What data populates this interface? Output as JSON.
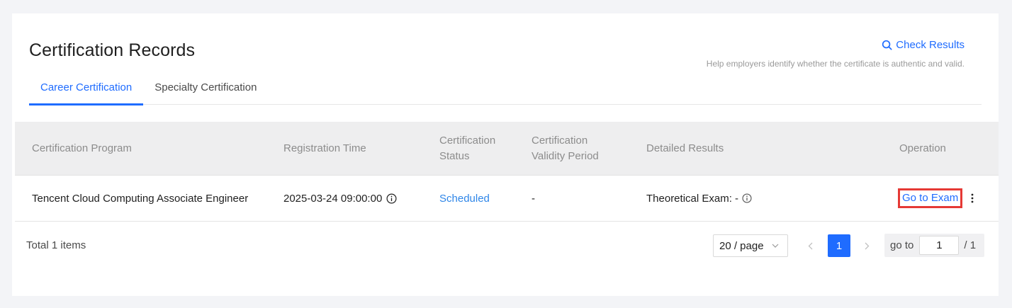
{
  "page": {
    "title": "Certification Records",
    "check_results_label": "Check Results",
    "help_text": "Help employers identify whether the certificate is authentic and valid."
  },
  "tabs": [
    {
      "label": "Career Certification",
      "active": true
    },
    {
      "label": "Specialty Certification",
      "active": false
    }
  ],
  "table": {
    "columns": [
      "Certification Program",
      "Registration Time",
      "Certification Status",
      "Certification Validity Period",
      "Detailed Results",
      "Operation"
    ],
    "rows": [
      {
        "program": "Tencent Cloud Computing Associate Engineer",
        "registration_time": "2025-03-24 09:00:00",
        "status": "Scheduled",
        "validity_period": "-",
        "detailed_results": "Theoretical Exam: -",
        "operation": "Go to Exam"
      }
    ]
  },
  "pagination": {
    "total_text": "Total 1 items",
    "page_size": "20 / page",
    "current_page": "1",
    "goto_label": "go to",
    "goto_value": "1",
    "total_pages": "/ 1"
  },
  "icons": {
    "search": "search-icon",
    "info": "info-icon",
    "more": "more-vertical-icon",
    "chevron_down": "chevron-down-icon",
    "prev": "chevron-left-icon",
    "next": "chevron-right-icon"
  },
  "colors": {
    "accent": "#1f6cff",
    "status_link": "#2f86e8",
    "highlight_border": "#e53935",
    "header_bg": "#eeeeef"
  }
}
